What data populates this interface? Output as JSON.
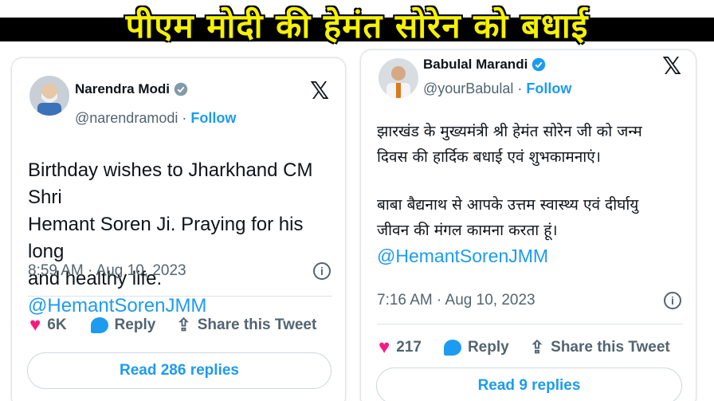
{
  "headline": "पीएम मोदी की हेमंत सोरेन को बधाई",
  "left_tweet": {
    "name": "Narendra Modi",
    "handle": "@narendramodi",
    "separator": "·",
    "follow": "Follow",
    "lines": [
      "Birthday wishes to Jharkhand CM Shri",
      "Hemant Soren Ji. Praying for his long"
    ],
    "last_line_text": "and healthy life.",
    "mention": "@HemantSorenJMM",
    "timestamp": "8:59 AM · Aug 10, 2023",
    "likes": "6K",
    "reply_label": "Reply",
    "share_label": "Share this Tweet",
    "read_replies": "Read 286 replies"
  },
  "right_tweet": {
    "name": "Babulal Marandi",
    "handle": "@yourBabulal",
    "separator": "·",
    "follow": "Follow",
    "para1": [
      "झारखंड के मुख्यमंत्री श्री हेमंत सोरेन जी को जन्म",
      "दिवस की हार्दिक बधाई एवं शुभकामनाएं।"
    ],
    "para2": [
      "बाबा बैद्यनाथ से आपके उत्तम स्वास्थ्य एवं दीर्घायु",
      "जीवन की मंगल कामना करता हूं।"
    ],
    "mention": "@HemantSorenJMM",
    "timestamp": "7:16 AM · Aug 10, 2023",
    "likes": "217",
    "reply_label": "Reply",
    "share_label": "Share this Tweet",
    "read_replies": "Read 9 replies"
  },
  "icons": {
    "x_logo": "𝕏",
    "info": "i",
    "heart": "♥",
    "share": "⇪"
  },
  "colors": {
    "headline_yellow": "#f5f200",
    "accent_blue": "#1d9bf0",
    "like_pink": "#f91880",
    "muted_gray": "#536471"
  }
}
